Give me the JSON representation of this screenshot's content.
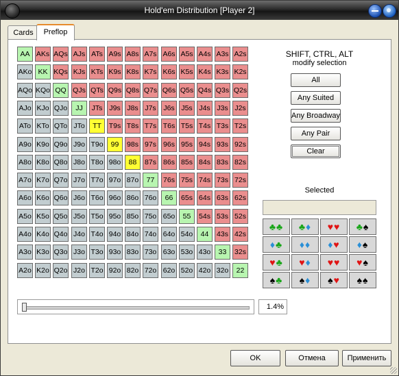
{
  "window": {
    "title": "Hold'em Distribution [Player 2]"
  },
  "tabs": [
    {
      "label": "Cards"
    },
    {
      "label": "Preflop"
    }
  ],
  "matrix": {
    "rows": [
      [
        "AA",
        "AKs",
        "AQs",
        "AJs",
        "ATs",
        "A9s",
        "A8s",
        "A7s",
        "A6s",
        "A5s",
        "A4s",
        "A3s",
        "A2s"
      ],
      [
        "AKo",
        "KK",
        "KQs",
        "KJs",
        "KTs",
        "K9s",
        "K8s",
        "K7s",
        "K6s",
        "K5s",
        "K4s",
        "K3s",
        "K2s"
      ],
      [
        "AQo",
        "KQo",
        "QQ",
        "QJs",
        "QTs",
        "Q9s",
        "Q8s",
        "Q7s",
        "Q6s",
        "Q5s",
        "Q4s",
        "Q3s",
        "Q2s"
      ],
      [
        "AJo",
        "KJo",
        "QJo",
        "JJ",
        "JTs",
        "J9s",
        "J8s",
        "J7s",
        "J6s",
        "J5s",
        "J4s",
        "J3s",
        "J2s"
      ],
      [
        "ATo",
        "KTo",
        "QTo",
        "JTo",
        "TT",
        "T9s",
        "T8s",
        "T7s",
        "T6s",
        "T5s",
        "T4s",
        "T3s",
        "T2s"
      ],
      [
        "A9o",
        "K9o",
        "Q9o",
        "J9o",
        "T9o",
        "99",
        "98s",
        "97s",
        "96s",
        "95s",
        "94s",
        "93s",
        "92s"
      ],
      [
        "A8o",
        "K8o",
        "Q8o",
        "J8o",
        "T8o",
        "98o",
        "88",
        "87s",
        "86s",
        "85s",
        "84s",
        "83s",
        "82s"
      ],
      [
        "A7o",
        "K7o",
        "Q7o",
        "J7o",
        "T7o",
        "97o",
        "87o",
        "77",
        "76s",
        "75s",
        "74s",
        "73s",
        "72s"
      ],
      [
        "A6o",
        "K6o",
        "Q6o",
        "J6o",
        "T6o",
        "96o",
        "86o",
        "76o",
        "66",
        "65s",
        "64s",
        "63s",
        "62s"
      ],
      [
        "A5o",
        "K5o",
        "Q5o",
        "J5o",
        "T5o",
        "95o",
        "85o",
        "75o",
        "65o",
        "55",
        "54s",
        "53s",
        "52s"
      ],
      [
        "A4o",
        "K4o",
        "Q4o",
        "J4o",
        "T4o",
        "94o",
        "84o",
        "74o",
        "64o",
        "54o",
        "44",
        "43s",
        "42s"
      ],
      [
        "A3o",
        "K3o",
        "Q3o",
        "J3o",
        "T3o",
        "93o",
        "83o",
        "73o",
        "63o",
        "53o",
        "43o",
        "33",
        "32s"
      ],
      [
        "A2o",
        "K2o",
        "Q2o",
        "J2o",
        "T2o",
        "92o",
        "82o",
        "72o",
        "62o",
        "52o",
        "42o",
        "32o",
        "22"
      ]
    ],
    "selected": [
      "TT",
      "99",
      "88"
    ]
  },
  "hint": {
    "line1": "SHIFT, CTRL, ALT",
    "line2": "modify selection"
  },
  "buttons": {
    "all": "All",
    "any_suited": "Any Suited",
    "any_broadway": "Any Broadway",
    "any_pair": "Any Pair",
    "clear": "Clear"
  },
  "selected_panel": {
    "label": "Selected",
    "value": ""
  },
  "suit_combos": [
    [
      "♣♣",
      "♣♦",
      "♥♥",
      "♣♠"
    ],
    [
      "♦♣",
      "♦♦",
      "♦♥",
      "♦♠"
    ],
    [
      "♥♣",
      "♥♦",
      "♥♥",
      "♥♠"
    ],
    [
      "♠♣",
      "♠♦",
      "♠♥",
      "♠♠"
    ]
  ],
  "suit_colors": {
    "♣": "#1aa61a",
    "♦": "#2a8fd6",
    "♥": "#e01414",
    "♠": "#000000"
  },
  "colors": {
    "pair": "#b8f5b0",
    "suited": "#ea8e8e",
    "offsuit": "#c2cdd0",
    "selected": "#ffff33"
  },
  "range_percent": {
    "value": 1.4,
    "text": "1.4%"
  },
  "footer": {
    "ok": "OK",
    "cancel": "Отмена",
    "apply": "Применить"
  }
}
